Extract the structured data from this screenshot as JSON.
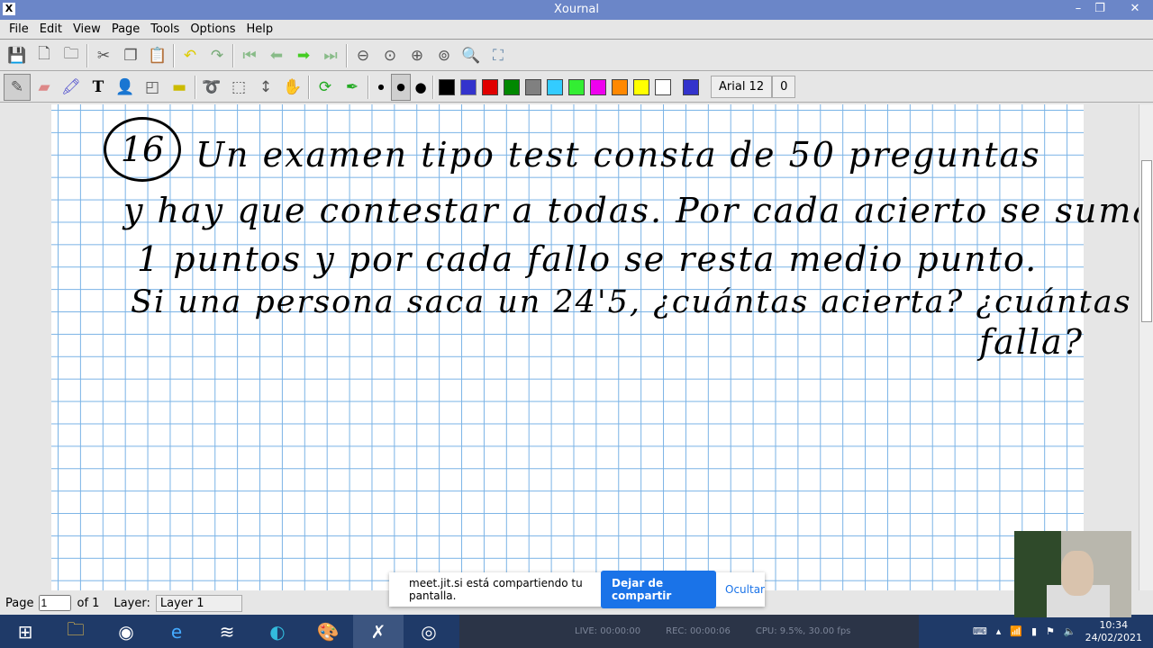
{
  "window": {
    "title": "Xournal",
    "minimize": "–",
    "maximize": "❐",
    "close": "✕"
  },
  "menu": [
    "File",
    "Edit",
    "View",
    "Page",
    "Tools",
    "Options",
    "Help"
  ],
  "toolbar": {
    "font": "Arial 12",
    "zero": "0"
  },
  "colors": [
    "#000000",
    "#3333cc",
    "#e00000",
    "#008800",
    "#808080",
    "#33ccff",
    "#33ee33",
    "#ee00ee",
    "#ff8800",
    "#ffff00",
    "#ffffff",
    "#3333cc"
  ],
  "note": {
    "number": "16",
    "lines": [
      "Un examen tipo test consta de 50 preguntas",
      "y hay que contestar a todas. Por cada acierto se suma",
      "1 puntos y por cada fallo se resta medio punto.",
      "Si una persona saca un 24'5, ¿cuántas acierta? ¿cuántas",
      "falla?"
    ]
  },
  "status": {
    "page_label": "Page",
    "page_value": "1",
    "of": "of 1",
    "layer_label": "Layer:",
    "layer_value": "Layer 1"
  },
  "share": {
    "message": "meet.jit.si está compartiendo tu pantalla.",
    "stop": "Dejar de compartir",
    "hide": "Ocultar"
  },
  "obs": {
    "live": "LIVE: 00:00:00",
    "rec": "REC: 00:00:06",
    "cpu": "CPU: 9.5%, 30.00 fps"
  },
  "clock": {
    "time": "10:34",
    "date": "24/02/2021"
  }
}
